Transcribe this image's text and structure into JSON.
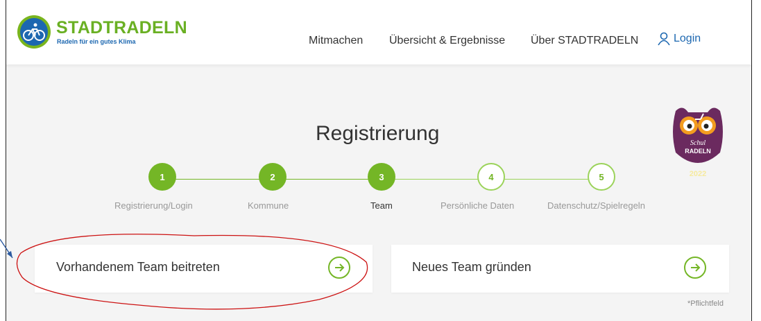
{
  "header": {
    "logo_title": "STADTRADELN",
    "logo_subtitle": "Radeln für ein gutes Klima",
    "nav": [
      "Mitmachen",
      "Übersicht & Ergebnisse",
      "Über STADTRADELN"
    ],
    "login_label": "Login"
  },
  "main": {
    "heading": "Registrierung",
    "steps": [
      {
        "number": "1",
        "label": "Registrierung/Login",
        "state": "done"
      },
      {
        "number": "2",
        "label": "Kommune",
        "state": "done"
      },
      {
        "number": "3",
        "label": "Team",
        "state": "current"
      },
      {
        "number": "4",
        "label": "Persönliche Daten",
        "state": "todo"
      },
      {
        "number": "5",
        "label": "Datenschutz/Spielregeln",
        "state": "todo"
      }
    ],
    "options": [
      {
        "label": "Vorhandenem Team beitreten"
      },
      {
        "label": "Neues Team gründen"
      }
    ],
    "required_note": "*Pflichtfeld"
  },
  "badge": {
    "line1": "Schul",
    "line2": "RADELN",
    "year": "2022"
  },
  "colors": {
    "brand_green": "#74b626",
    "brand_blue": "#1c67b0",
    "badge_purple": "#6b2a5f",
    "annotation_red": "#cc1111"
  },
  "icons": [
    "bicycle-logo-icon",
    "user-icon",
    "arrow-right-circle-icon",
    "owl-badge-icon"
  ]
}
